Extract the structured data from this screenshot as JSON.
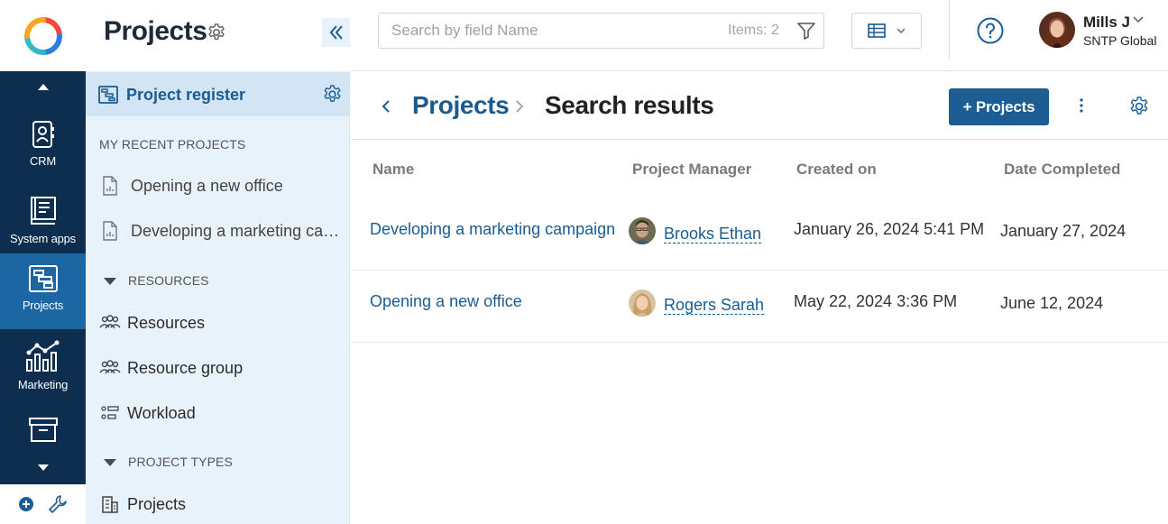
{
  "rail": {
    "items": [
      {
        "label": "CRM",
        "icon": "crm-icon"
      },
      {
        "label": "System apps",
        "icon": "book-icon"
      },
      {
        "label": "Projects",
        "icon": "projects-icon",
        "active": true
      },
      {
        "label": "Marketing",
        "icon": "chart-icon"
      },
      {
        "label": "",
        "icon": "archive-icon"
      }
    ]
  },
  "sidebar": {
    "title": "Projects",
    "selected": "Project register",
    "recent_label": "MY RECENT PROJECTS",
    "recent": [
      "Opening a new office",
      "Developing a marketing campaign"
    ],
    "resources_label": "RESOURCES",
    "resources": [
      "Resources",
      "Resource group",
      "Workload"
    ],
    "types_label": "PROJECT TYPES",
    "types": [
      "Projects"
    ]
  },
  "topbar": {
    "search_placeholder": "Search by field Name",
    "items_count": "Items: 2",
    "user_name": "Mills J",
    "user_org": "SNTP Global"
  },
  "page": {
    "breadcrumb_parent": "Projects",
    "breadcrumb_current": "Search results",
    "add_button": "+ Projects"
  },
  "table": {
    "columns": [
      "Name",
      "Project Manager",
      "Created on",
      "Date Completed"
    ],
    "rows": [
      {
        "name": "Developing a marketing campaign",
        "manager": "Brooks Ethan",
        "created": "January 26, 2024 5:41 PM",
        "completed": "January 27, 2024"
      },
      {
        "name": "Opening a new office",
        "manager": "Rogers Sarah",
        "created": "May 22, 2024 3:36 PM",
        "completed": "June 12, 2024"
      }
    ]
  },
  "colors": {
    "accent": "#1c5d93",
    "rail": "#0d2e4e",
    "rail_active": "#1c67a3",
    "sidebar_bg": "#e8f2fb"
  }
}
